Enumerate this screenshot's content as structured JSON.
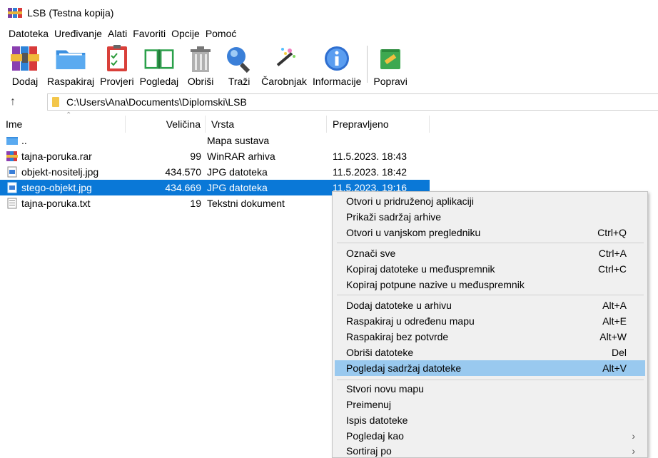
{
  "window": {
    "title": "LSB (Testna kopija)"
  },
  "menu": [
    "Datoteka",
    "Uređivanje",
    "Alati",
    "Favoriti",
    "Opcije",
    "Pomoć"
  ],
  "toolbar": [
    {
      "label": "Dodaj",
      "icon": "add-archive-icon"
    },
    {
      "label": "Raspakiraj",
      "icon": "extract-icon"
    },
    {
      "label": "Provjeri",
      "icon": "test-icon"
    },
    {
      "label": "Pogledaj",
      "icon": "view-icon"
    },
    {
      "label": "Obriši",
      "icon": "delete-icon"
    },
    {
      "label": "Traži",
      "icon": "find-icon"
    },
    {
      "label": "Čarobnjak",
      "icon": "wizard-icon"
    },
    {
      "label": "Informacije",
      "icon": "info-icon"
    },
    {
      "label": "Popravi",
      "icon": "repair-icon"
    }
  ],
  "address": {
    "path": "C:\\Users\\Ana\\Documents\\Diplomski\\LSB"
  },
  "columns": {
    "name": "Ime",
    "size": "Veličina",
    "type": "Vrsta",
    "modified": "Prepravljeno"
  },
  "files": [
    {
      "name": "..",
      "size": "",
      "type": "Mapa sustava",
      "modified": "",
      "icon": "folder-icon"
    },
    {
      "name": "tajna-poruka.rar",
      "size": "99",
      "type": "WinRAR arhiva",
      "modified": "11.5.2023. 18:43",
      "icon": "rar-file-icon"
    },
    {
      "name": "objekt-nositelj.jpg",
      "size": "434.570",
      "type": "JPG datoteka",
      "modified": "11.5.2023. 18:42",
      "icon": "image-file-icon"
    },
    {
      "name": "stego-objekt.jpg",
      "size": "434.669",
      "type": "JPG datoteka",
      "modified": "11.5.2023. 19:16",
      "icon": "image-file-icon",
      "selected": true
    },
    {
      "name": "tajna-poruka.txt",
      "size": "19",
      "type": "Tekstni dokument",
      "modified": "",
      "icon": "text-file-icon"
    }
  ],
  "context_menu": {
    "groups": [
      [
        {
          "label": "Otvori u pridruženoj aplikaciji",
          "shortcut": ""
        },
        {
          "label": "Prikaži sadržaj arhive",
          "shortcut": ""
        },
        {
          "label": "Otvori u vanjskom pregledniku",
          "shortcut": "Ctrl+Q"
        }
      ],
      [
        {
          "label": "Označi sve",
          "shortcut": "Ctrl+A"
        },
        {
          "label": "Kopiraj datoteke u međuspremnik",
          "shortcut": "Ctrl+C"
        },
        {
          "label": "Kopiraj potpune nazive u međuspremnik",
          "shortcut": ""
        }
      ],
      [
        {
          "label": "Dodaj datoteke u arhivu",
          "shortcut": "Alt+A"
        },
        {
          "label": "Raspakiraj u određenu mapu",
          "shortcut": "Alt+E"
        },
        {
          "label": "Raspakiraj bez potvrde",
          "shortcut": "Alt+W"
        },
        {
          "label": "Obriši datoteke",
          "shortcut": "Del"
        },
        {
          "label": "Pogledaj sadržaj datoteke",
          "shortcut": "Alt+V",
          "highlighted": true
        }
      ],
      [
        {
          "label": "Stvori novu mapu",
          "shortcut": ""
        },
        {
          "label": "Preimenuj",
          "shortcut": ""
        },
        {
          "label": "Ispis datoteke",
          "shortcut": ""
        },
        {
          "label": "Pogledaj kao",
          "shortcut": "",
          "submenu": true
        },
        {
          "label": "Sortiraj po",
          "shortcut": "",
          "submenu": true
        }
      ]
    ]
  },
  "colors": {
    "selection": "#0a78d7",
    "menu_highlight": "#99c9ef",
    "menu_background": "#f0f0f0"
  }
}
